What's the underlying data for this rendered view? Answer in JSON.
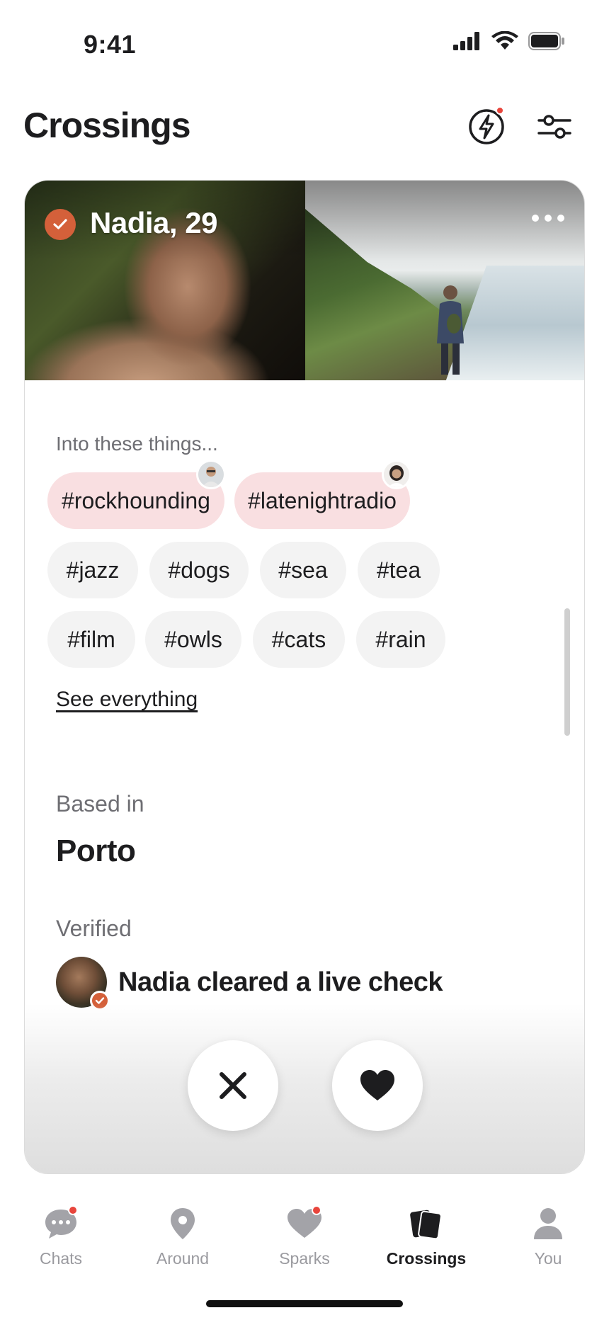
{
  "status_bar": {
    "time": "9:41"
  },
  "header": {
    "title": "Crossings"
  },
  "profile": {
    "name_age": "Nadia, 29",
    "interests_label": "Into these things...",
    "shared_interests": [
      "#rockhounding",
      "#latenightradio"
    ],
    "interests": [
      "#jazz",
      "#dogs",
      "#sea",
      "#tea",
      "#film",
      "#owls",
      "#cats",
      "#rain"
    ],
    "see_all_label": "See everything",
    "based_label": "Based in",
    "based_value": "Porto",
    "verified_label": "Verified",
    "verified_text": "Nadia cleared a live check"
  },
  "tabs": [
    {
      "label": "Chats",
      "icon": "chat-bubble-icon",
      "badge": true
    },
    {
      "label": "Around",
      "icon": "location-pin-icon",
      "badge": false
    },
    {
      "label": "Sparks",
      "icon": "heart-icon",
      "badge": true
    },
    {
      "label": "Crossings",
      "icon": "cards-icon",
      "badge": false,
      "active": true
    },
    {
      "label": "You",
      "icon": "person-icon",
      "badge": false
    }
  ],
  "colors": {
    "accent": "#d4603a",
    "notification": "#e8453c",
    "shared_chip": "#f9dfe1",
    "chip": "#f3f3f3"
  }
}
